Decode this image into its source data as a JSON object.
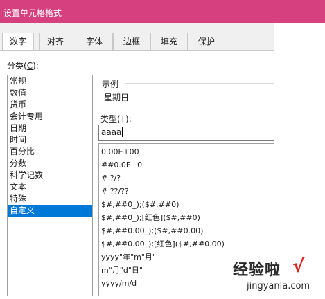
{
  "title": "设置单元格格式",
  "tabs": [
    {
      "label": "数字",
      "active": true
    },
    {
      "label": "对齐",
      "active": false
    },
    {
      "label": "字体",
      "active": false
    },
    {
      "label": "边框",
      "active": false
    },
    {
      "label": "填充",
      "active": false
    },
    {
      "label": "保护",
      "active": false
    }
  ],
  "category_label_pre": "分类(",
  "category_label_key": "C",
  "category_label_post": "):",
  "categories": [
    "常规",
    "数值",
    "货币",
    "会计专用",
    "日期",
    "时间",
    "百分比",
    "分数",
    "科学记数",
    "文本",
    "特殊",
    "自定义"
  ],
  "selected_category": "自定义",
  "sample_label": "示例",
  "sample_value": "星期日",
  "type_label_pre": "类型(",
  "type_label_key": "T",
  "type_label_post": "):",
  "type_value": "aaaa",
  "formats": [
    "0.00E+00",
    "##0.0E+0",
    "# ?/?",
    "# ??/??",
    "$#,##0_);($#,##0)",
    "$#,##0_);[红色]($#,##0)",
    "$#,##0.00_);($#,##0.00)",
    "$#,##0.00_);[红色]($#,##0.00)",
    "yyyy\"年\"m\"月\"",
    "m\"月\"d\"日\"",
    "yyyy/m/d"
  ],
  "watermark": {
    "main": "经验啦",
    "url": "jingyanla.com",
    "check": "√"
  },
  "colors": {
    "titlebar": "#d6407e",
    "selection": "#0078d7",
    "check": "#e02020"
  }
}
